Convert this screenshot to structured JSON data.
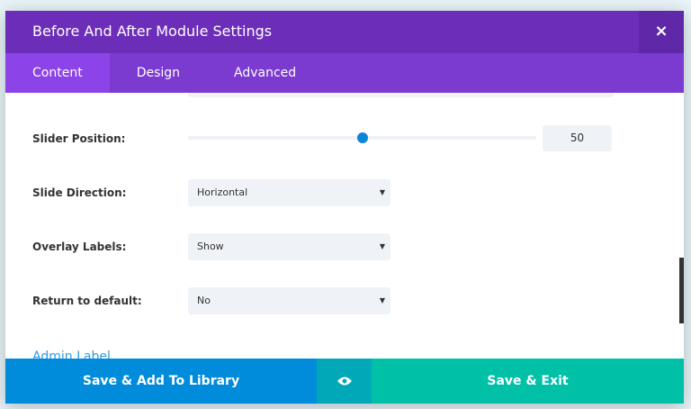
{
  "header": {
    "title": "Before And After Module Settings",
    "close_label": "×"
  },
  "tabs": [
    {
      "label": "Content"
    },
    {
      "label": "Design"
    },
    {
      "label": "Advanced"
    }
  ],
  "fields": {
    "slider_position": {
      "label": "Slider Position:",
      "value": "50",
      "percent": 50
    },
    "slide_direction": {
      "label": "Slide Direction:",
      "value": "Horizontal"
    },
    "overlay_labels": {
      "label": "Overlay Labels:",
      "value": "Show"
    },
    "return_default": {
      "label": "Return to default:",
      "value": "No"
    },
    "admin_label": {
      "label": "Admin Label"
    }
  },
  "footer": {
    "save_library": "Save & Add To Library",
    "save_exit": "Save & Exit"
  },
  "colors": {
    "header": "#6c2eb9",
    "tabs": "#7b3bd0",
    "save_library": "#008bdb",
    "preview": "#00a8b8",
    "save_exit": "#00c1a8"
  }
}
